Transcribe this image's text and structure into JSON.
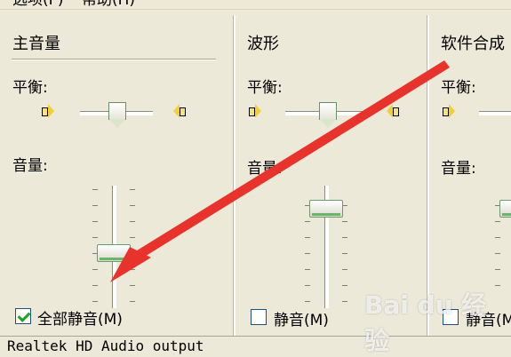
{
  "menubar": {
    "options_label": "选项(P)",
    "help_label": "帮助(H)"
  },
  "columns": [
    {
      "title": "主音量",
      "balance_label": "平衡:",
      "volume_label": "音量:",
      "mute_label": "全部静音(M)",
      "muted": true,
      "balance_level": 0.5,
      "volume_level": 0.5
    },
    {
      "title": "波形",
      "balance_label": "平衡:",
      "volume_label": "音量:",
      "mute_label": "静音(M)",
      "muted": false,
      "balance_level": 0.5,
      "volume_level": 1.0
    },
    {
      "title": "软件合成",
      "balance_label": "平衡:",
      "volume_label": "音量:",
      "mute_label": "静音(M)",
      "muted": false
    }
  ],
  "status": {
    "device": "Realtek HD Audio output"
  },
  "watermark": "Bai du 经验",
  "colors": {
    "window_bg": "#ece9d8",
    "arrow": "#e8322c",
    "check": "#21a121"
  }
}
